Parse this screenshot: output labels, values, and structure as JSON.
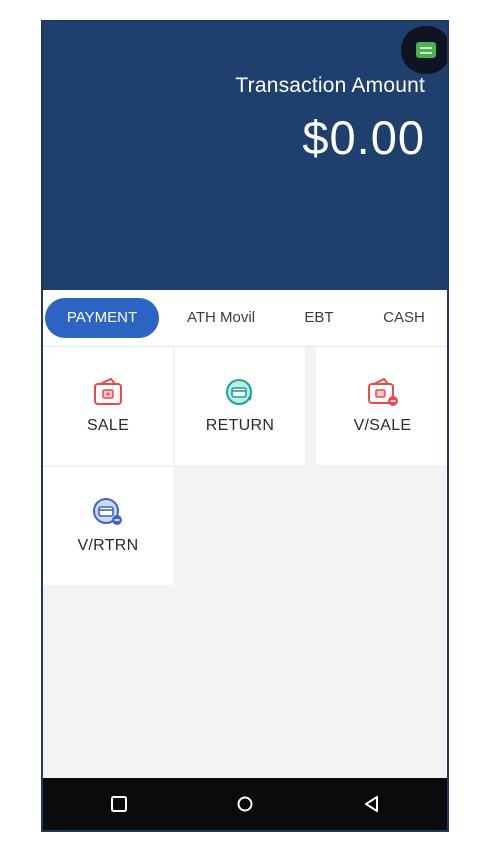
{
  "header": {
    "amount_label": "Transaction Amount",
    "amount_value": "$0.00"
  },
  "tabs": [
    {
      "label": "PAYMENT",
      "active": true
    },
    {
      "label": "ATH Movil",
      "active": false
    },
    {
      "label": "EBT",
      "active": false
    },
    {
      "label": "CASH",
      "active": false
    }
  ],
  "actions": [
    {
      "label": "SALE",
      "icon": "wallet-icon"
    },
    {
      "label": "RETURN",
      "icon": "return-icon"
    },
    {
      "label": "V/SALE",
      "icon": "void-sale-icon"
    },
    {
      "label": "V/RTRN",
      "icon": "void-return-icon"
    }
  ],
  "colors": {
    "header_bg": "#1f3f6f",
    "tab_active": "#2c64c4",
    "icon_red": "#e84b4b",
    "icon_teal": "#17a596",
    "icon_blue": "#3f66c7"
  },
  "navbar": {
    "icons": [
      "square-recent-icon",
      "circle-home-icon",
      "triangle-back-icon"
    ]
  }
}
